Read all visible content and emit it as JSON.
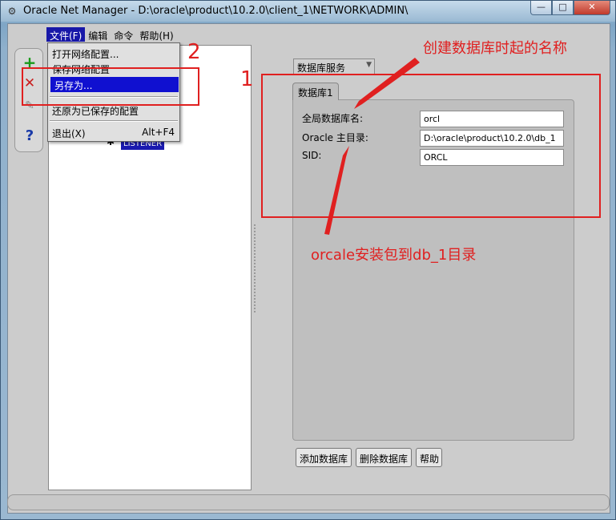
{
  "window": {
    "title": "Oracle Net Manager - D:\\oracle\\product\\10.2.0\\client_1\\NETWORK\\ADMIN\\",
    "minimize": "—",
    "maximize": "□",
    "close": "✕"
  },
  "menubar": [
    {
      "label": "文件(F)",
      "active": true
    },
    {
      "label": "编辑"
    },
    {
      "label": "命令"
    },
    {
      "label": "帮助(H)"
    }
  ],
  "file_menu": {
    "open": "打开网络配置...",
    "save": "保存网络配置",
    "save_as": "另存为...",
    "revert": "还原为已保存的配置",
    "exit": "退出(X)",
    "exit_accel": "Alt+F4"
  },
  "tree": {
    "node_label": "LISTENER"
  },
  "right": {
    "combo": "数据库服务",
    "tab": "数据库1",
    "fields": [
      {
        "label": "全局数据库名:",
        "value": "orcl"
      },
      {
        "label": "Oracle 主目录:",
        "value": "D:\\oracle\\product\\10.2.0\\db_1"
      },
      {
        "label": "SID:",
        "value": "ORCL"
      }
    ],
    "buttons": {
      "add": "添加数据库",
      "delete": "删除数据库",
      "help": "帮助"
    }
  },
  "annotations": {
    "num1": "1",
    "num2": "2",
    "top_note": "创建数据库时起的名称",
    "mid_note": "orcale安装包到db_1目录",
    "color": "#e02020"
  }
}
